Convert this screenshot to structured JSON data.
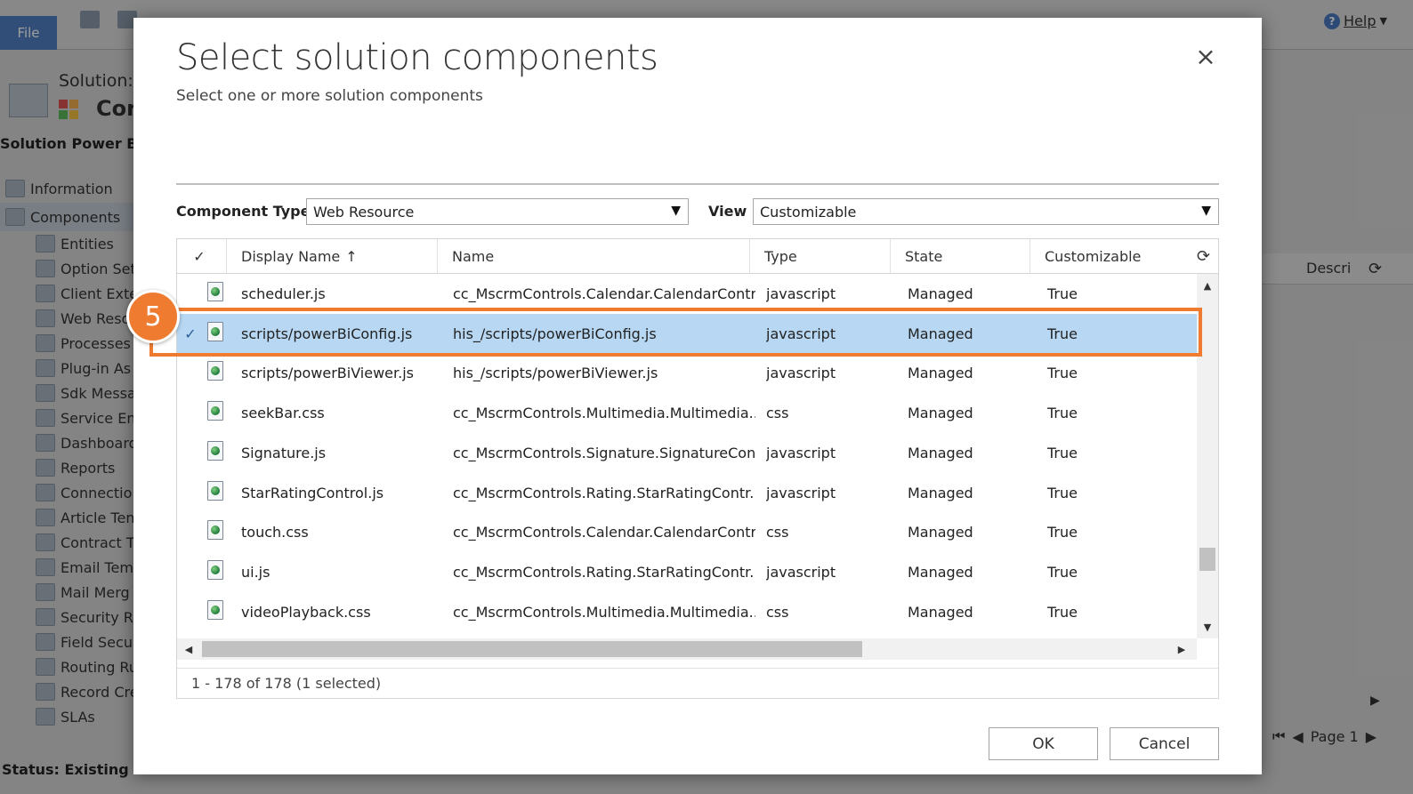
{
  "background": {
    "file_tab": "File",
    "help_label": "Help",
    "solution_label": "Solution:",
    "solution_name_partial": "Cor",
    "solution_title_partial": "Solution Power BI V",
    "nav": [
      {
        "label": "Information",
        "level": "top"
      },
      {
        "label": "Components",
        "level": "top",
        "active": true
      },
      {
        "label": "Entities",
        "level": "sub"
      },
      {
        "label": "Option Set",
        "level": "sub"
      },
      {
        "label": "Client Exte",
        "level": "sub"
      },
      {
        "label": "Web Reso",
        "level": "sub"
      },
      {
        "label": "Processes",
        "level": "sub"
      },
      {
        "label": "Plug-in As",
        "level": "sub"
      },
      {
        "label": "Sdk Messa",
        "level": "sub"
      },
      {
        "label": "Service En",
        "level": "sub"
      },
      {
        "label": "Dashboard",
        "level": "sub"
      },
      {
        "label": "Reports",
        "level": "sub"
      },
      {
        "label": "Connectio",
        "level": "sub"
      },
      {
        "label": "Article Ten",
        "level": "sub"
      },
      {
        "label": "Contract T",
        "level": "sub"
      },
      {
        "label": "Email Tem",
        "level": "sub"
      },
      {
        "label": "Mail Merg",
        "level": "sub"
      },
      {
        "label": "Security R",
        "level": "sub"
      },
      {
        "label": "Field Secu",
        "level": "sub"
      },
      {
        "label": "Routing Ru",
        "level": "sub"
      },
      {
        "label": "Record Cre",
        "level": "sub"
      },
      {
        "label": "SLAs",
        "level": "sub"
      }
    ],
    "status": "Status: Existing",
    "descr_col": "Descri",
    "pager_label": "Page 1"
  },
  "dialog": {
    "title": "Select solution components",
    "subtitle": "Select one or more solution components",
    "close_symbol": "×",
    "component_type_label": "Component Type",
    "component_type_value": "Web Resource",
    "view_label": "View",
    "view_value": "Customizable",
    "columns": {
      "check": "✓",
      "display_name": "Display Name",
      "sort_arrow": "↑",
      "name": "Name",
      "type": "Type",
      "state": "State",
      "customizable": "Customizable"
    },
    "rows": [
      {
        "display_name": "scheduler.js",
        "name": "cc_MscrmControls.Calendar.CalendarContr...",
        "type": "javascript",
        "state": "Managed",
        "customizable": "True",
        "check": ""
      },
      {
        "display_name": "scripts/powerBiConfig.js",
        "name": "his_/scripts/powerBiConfig.js",
        "type": "javascript",
        "state": "Managed",
        "customizable": "True",
        "check": "✓",
        "selected": true
      },
      {
        "display_name": "scripts/powerBiViewer.js",
        "name": "his_/scripts/powerBiViewer.js",
        "type": "javascript",
        "state": "Managed",
        "customizable": "True",
        "check": ""
      },
      {
        "display_name": "seekBar.css",
        "name": "cc_MscrmControls.Multimedia.Multimedia...",
        "type": "css",
        "state": "Managed",
        "customizable": "True",
        "check": ""
      },
      {
        "display_name": "Signature.js",
        "name": "cc_MscrmControls.Signature.SignatureCon...",
        "type": "javascript",
        "state": "Managed",
        "customizable": "True",
        "check": ""
      },
      {
        "display_name": "StarRatingControl.js",
        "name": "cc_MscrmControls.Rating.StarRatingContr...",
        "type": "javascript",
        "state": "Managed",
        "customizable": "True",
        "check": ""
      },
      {
        "display_name": "touch.css",
        "name": "cc_MscrmControls.Calendar.CalendarContr...",
        "type": "css",
        "state": "Managed",
        "customizable": "True",
        "check": ""
      },
      {
        "display_name": "ui.js",
        "name": "cc_MscrmControls.Rating.StarRatingContr...",
        "type": "javascript",
        "state": "Managed",
        "customizable": "True",
        "check": ""
      },
      {
        "display_name": "videoPlayback.css",
        "name": "cc_MscrmControls.Multimedia.Multimedia...",
        "type": "css",
        "state": "Managed",
        "customizable": "True",
        "check": ""
      }
    ],
    "footer_text": "1 - 178 of 178 (1 selected)",
    "ok_label": "OK",
    "cancel_label": "Cancel",
    "step_number": "5"
  },
  "icons": [
    "save-icon",
    "help-icon",
    "close-icon",
    "dropdown-caret-icon",
    "sort-up-icon",
    "refresh-icon",
    "web-resource-file-icon",
    "scroll-up-icon",
    "scroll-down-icon",
    "scroll-left-icon",
    "scroll-right-icon"
  ],
  "colors": {
    "accent_orange": "#ee7b30",
    "selected_row": "#b7d7f2",
    "file_tab_blue": "#4f7fc4"
  }
}
